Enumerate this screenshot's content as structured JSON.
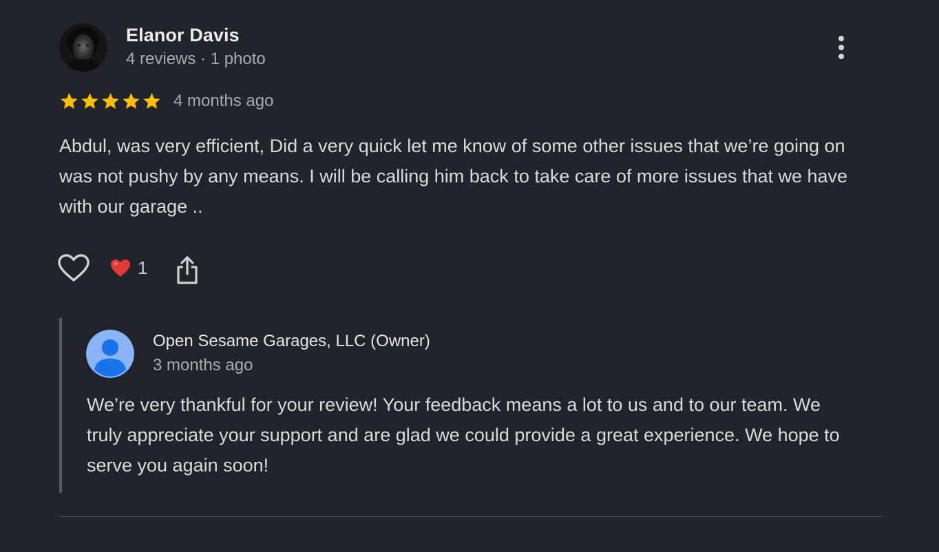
{
  "review": {
    "reviewer": {
      "name": "Elanor Davis",
      "meta": "4 reviews · 1 photo",
      "avatar_icon": "user-photo"
    },
    "rating": {
      "stars": 5,
      "max": 5,
      "star_color": "#fbbc04"
    },
    "date": "4 months ago",
    "text": "Abdul, was very efficient, Did a very quick let me know of some other issues that we’re going on was not pushy by any means. I will be calling him back to take care of more issues that we have with our garage ..",
    "actions": {
      "like_icon": "heart-outline-icon",
      "reaction_icon": "red-heart-emoji",
      "reaction_count": "1",
      "share_icon": "share-icon"
    },
    "more_icon": "more-vert-icon"
  },
  "owner_reply": {
    "name": "Open Sesame Garages, LLC (Owner)",
    "date": "3 months ago",
    "text": "We’re very thankful for your review! Your feedback means a lot to us and to our team. We truly appreciate your support and are glad we could provide a great experience. We hope to serve you again soon!",
    "avatar_icon": "default-profile-icon",
    "avatar_color": "#8ab4f8"
  },
  "colors": {
    "background": "#22242b",
    "primary_text": "#d9dadd",
    "secondary_text": "#a9abb0",
    "reaction_heart": "#e53935"
  }
}
